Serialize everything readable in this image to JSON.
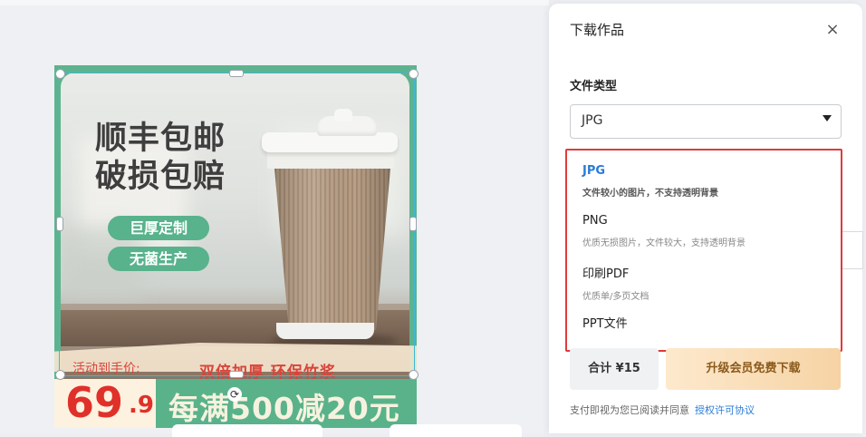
{
  "design": {
    "headline_line1": "顺丰包邮",
    "headline_line2": "破损包赔",
    "pill1": "巨厚定制",
    "pill2": "无菌生产",
    "activity_label": "活动到手价:",
    "slogan": "双倍加厚  环保竹浆",
    "price_integer": "69",
    "price_decimal": ".9",
    "promo": "每满500减20元"
  },
  "panel": {
    "title": "下载作品",
    "close_icon": "×",
    "file_type_label": "文件类型",
    "selected_value": "JPG",
    "options": [
      {
        "title": "JPG",
        "desc": "文件较小的图片，不支持透明背景"
      },
      {
        "title": "PNG",
        "desc": "优质无损图片，文件较大，支持透明背景"
      },
      {
        "title": "印刷PDF",
        "desc": "优质单/多页文档"
      },
      {
        "title": "PPT文件",
        "desc": ""
      }
    ],
    "total": "合计 ¥15",
    "upgrade_button": "升级会员免费下载",
    "agreement_text": "支付即视为您已阅读并同意",
    "agreement_link": "授权许可协议"
  },
  "colors": {
    "brand_green": "#5cb38e",
    "price_red": "#e0302a",
    "link_blue": "#2b7bd6",
    "highlight_red_border": "#e03a3a"
  },
  "icons": {
    "close": "close-icon",
    "caret": "chevron-down-icon",
    "rotate": "rotate-icon"
  }
}
